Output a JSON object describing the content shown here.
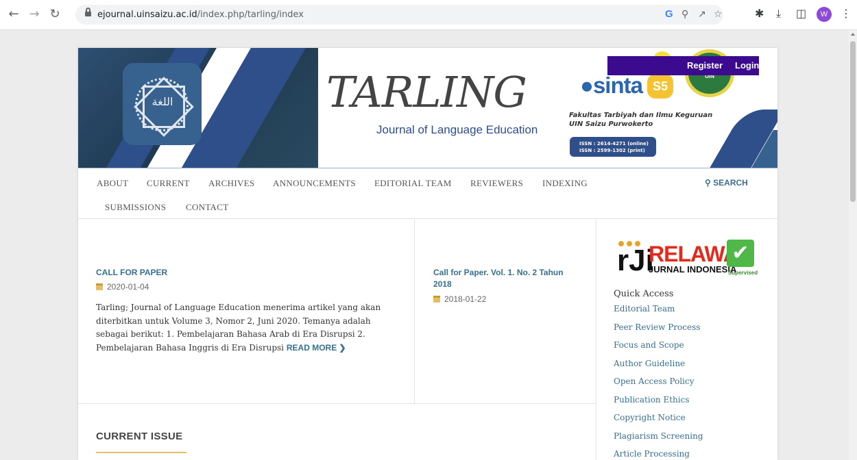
{
  "browser": {
    "url_host": "ejournal.uinsaizu.ac.id",
    "url_path": "/index.php/tarling/index",
    "avatar_letter": "W",
    "icons": [
      "back-icon",
      "forward-icon",
      "reload-icon",
      "lock-icon",
      "google-icon",
      "zoom-icon",
      "share-icon",
      "star-icon",
      "extensions-icon",
      "download-icon",
      "sidebar-icon",
      "menu-icon"
    ]
  },
  "header": {
    "title": "TARLING",
    "subtitle": "Journal of Language Education",
    "logo_text": "اللغة",
    "register": "Register",
    "login": "Login",
    "sinta_text": "sinta",
    "sinta_level": "S5",
    "seal_text": "UIN",
    "faculty_line1": "Fakultas Tarbiyah dan Ilmu Keguruan",
    "faculty_line2": "UIN Saizu Purwokerto",
    "issn_online": "ISSN : 2614-4271 (online)",
    "issn_print": "ISSN : 2599-1302 (print)"
  },
  "nav": {
    "items": [
      "ABOUT",
      "CURRENT",
      "ARCHIVES",
      "ANNOUNCEMENTS",
      "EDITORIAL TEAM",
      "REVIEWERS",
      "INDEXING",
      "SUBMISSIONS",
      "CONTACT"
    ],
    "search": "SEARCH"
  },
  "announcements": [
    {
      "title": "CALL FOR PAPER",
      "date": "2020-01-04",
      "body": "Tarling; Journal of Language Education menerima artikel yang akan diterbitkan untuk Volume 3, Nomor 2, Juni 2020. Temanya adalah sebagai berikut: 1. Pembelajaran Bahasa Arab di Era Disrupsi 2. Pembelajaran Bahasa Inggris di Era Disrupsi",
      "read_more": "READ MORE"
    },
    {
      "title_line1": "Call for Paper. Vol. 1. No. 2 Tahun",
      "title_line2": "2018",
      "date": "2018-01-22"
    }
  ],
  "current_issue": "CURRENT ISSUE",
  "sidebar": {
    "relawan_word": "RELAWAN",
    "relawan_sub": "JURNAL INDONESIA",
    "relawan_badge": "Supervised",
    "quick_access_title": "Quick Access",
    "links": [
      "Editorial Team",
      "Peer Review Process",
      "Focus and Scope",
      "Author Guideline",
      "Open Access Policy",
      "Publication Ethics",
      "Copyright Notice",
      "Plagiarism Screening",
      "Article Processing"
    ]
  },
  "colors": {
    "accent": "#35708f",
    "banner_blue": "#2f4f8a",
    "register_bar": "#3b0a8f",
    "gold": "#e3c068"
  }
}
